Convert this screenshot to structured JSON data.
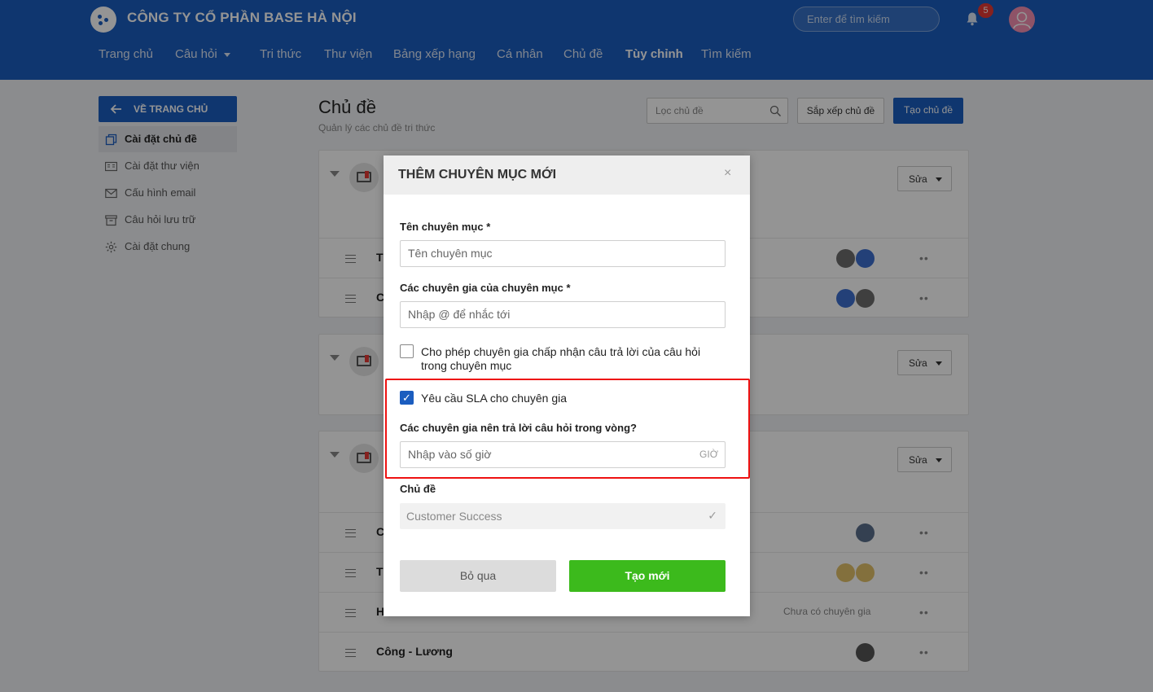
{
  "header": {
    "company": "CÔNG TY CỔ PHẦN BASE HÀ NỘI",
    "search_placeholder": "Enter để tìm kiếm",
    "notification_count": "5",
    "nav": [
      {
        "label": "Trang chủ"
      },
      {
        "label": "Câu hỏi"
      },
      {
        "label": "Tri thức"
      },
      {
        "label": "Thư viện"
      },
      {
        "label": "Bảng xếp hạng"
      },
      {
        "label": "Cá nhân"
      },
      {
        "label": "Chủ đề"
      },
      {
        "label": "Tùy chỉnh"
      },
      {
        "label": "Tìm kiếm"
      }
    ]
  },
  "sidebar": {
    "back_label": "VỀ TRANG CHỦ",
    "items": [
      {
        "label": "Cài đặt chủ đề",
        "icon": "copy-icon"
      },
      {
        "label": "Cài đặt thư viện",
        "icon": "library-icon"
      },
      {
        "label": "Cấu hình email",
        "icon": "mail-icon"
      },
      {
        "label": "Câu hỏi lưu trữ",
        "icon": "archive-icon"
      },
      {
        "label": "Cài đặt chung",
        "icon": "gear-icon"
      }
    ]
  },
  "main": {
    "title": "Chủ đề",
    "subtitle": "Quản lý các chủ đề tri thức",
    "filter_placeholder": "Lọc chủ đề",
    "sort_label": "Sắp xếp chủ đề",
    "create_label": "Tạo chủ đề",
    "edit_label": "Sửa",
    "cards": [
      {
        "rows": [
          {
            "name": "T"
          },
          {
            "name": "C"
          }
        ]
      },
      {
        "rows": []
      },
      {
        "rows": [
          {
            "name": "C"
          },
          {
            "name": "T"
          },
          {
            "name": "H",
            "note": "Chưa có chuyên gia"
          },
          {
            "name": "Công - Lương"
          }
        ]
      }
    ]
  },
  "modal": {
    "title": "THÊM CHUYÊN MỤC MỚI",
    "close": "×",
    "name_label": "Tên chuyên mục *",
    "name_placeholder": "Tên chuyên mục",
    "experts_label": "Các chuyên gia của chuyên mục *",
    "experts_placeholder": "Nhập @ để nhắc tới",
    "allow_accept_label": "Cho phép chuyên gia chấp nhận câu trả lời của câu hỏi trong chuyên mục",
    "allow_accept_checked": false,
    "sla_label": "Yêu cầu SLA cho chuyên gia",
    "sla_checked": true,
    "sla_hours_label": "Các chuyên gia nên trả lời câu hỏi trong vòng?",
    "sla_hours_placeholder": "Nhập vào số giờ",
    "sla_unit": "GIỜ",
    "topic_label": "Chủ đề",
    "topic_value": "Customer Success",
    "topic_check": "✓",
    "check_mark": "✓",
    "skip_label": "Bỏ qua",
    "create_label": "Tạo mới"
  }
}
